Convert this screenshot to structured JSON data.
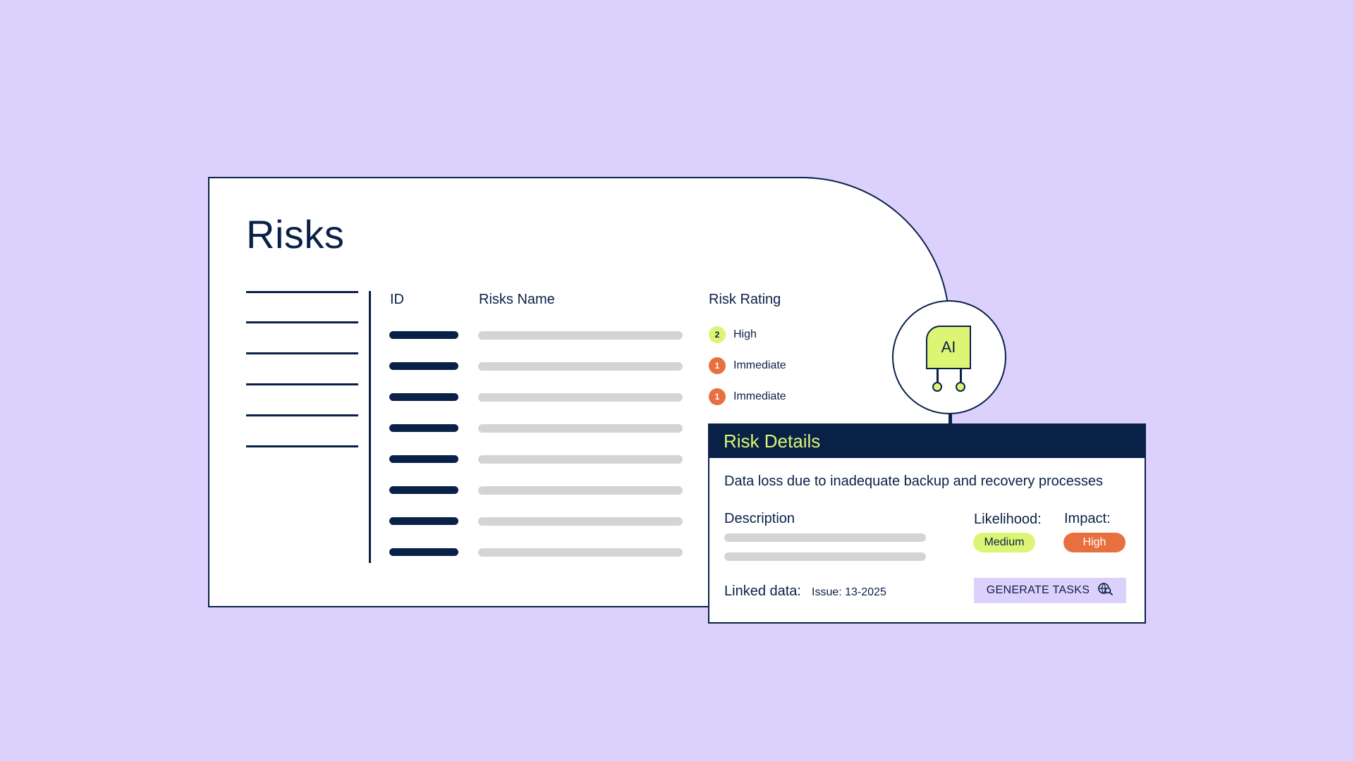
{
  "page": {
    "title": "Risks"
  },
  "table": {
    "headers": {
      "id": "ID",
      "name": "Risks Name",
      "rating": "Risk Rating"
    },
    "ratings": [
      {
        "count": "2",
        "label": "High",
        "color": "#dcf574"
      },
      {
        "count": "1",
        "label": "Immediate",
        "color": "#e8703f"
      },
      {
        "count": "1",
        "label": "Immediate",
        "color": "#e8703f"
      }
    ]
  },
  "ai": {
    "label": "AI"
  },
  "details": {
    "header": "Risk Details",
    "summary": "Data loss due to inadequate backup and recovery processes",
    "description_label": "Description",
    "likelihood_label": "Likelihood:",
    "likelihood_value": "Medium",
    "impact_label": "Impact:",
    "impact_value": "High",
    "linked_label": "Linked data:",
    "linked_value": "Issue: 13-2025",
    "generate_button": "GENERATE TASKS",
    "generate_icon": "ai-search-icon"
  },
  "colors": {
    "background": "#dcd0fd",
    "navy": "#0a2147",
    "lime": "#dcf574",
    "orange": "#e8703f",
    "placeholder": "#d4d4d4"
  }
}
